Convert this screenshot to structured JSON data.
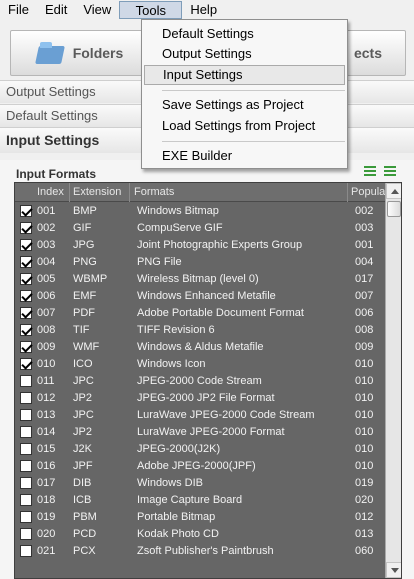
{
  "menubar": {
    "items": [
      {
        "label": "File"
      },
      {
        "label": "Edit"
      },
      {
        "label": "View"
      },
      {
        "label": "Tools"
      },
      {
        "label": "Help"
      }
    ]
  },
  "toolbar": {
    "folders_label": "Folders",
    "projects_label_visible": "ects"
  },
  "accordion": {
    "output_settings": "Output Settings",
    "default_settings": "Default Settings",
    "input_settings": "Input Settings"
  },
  "panel": {
    "title": "Input Formats"
  },
  "grid": {
    "columns": [
      "Index",
      "Extension",
      "Formats",
      "Popularity"
    ],
    "rows": [
      {
        "checked": true,
        "index": "001",
        "ext": "BMP",
        "format": "Windows Bitmap",
        "pop": "002"
      },
      {
        "checked": true,
        "index": "002",
        "ext": "GIF",
        "format": "CompuServe GIF",
        "pop": "003"
      },
      {
        "checked": true,
        "index": "003",
        "ext": "JPG",
        "format": "Joint Photographic Experts Group",
        "pop": "001"
      },
      {
        "checked": true,
        "index": "004",
        "ext": "PNG",
        "format": "PNG File",
        "pop": "004"
      },
      {
        "checked": true,
        "index": "005",
        "ext": "WBMP",
        "format": "Wireless Bitmap (level 0)",
        "pop": "017"
      },
      {
        "checked": true,
        "index": "006",
        "ext": "EMF",
        "format": "Windows Enhanced Metafile",
        "pop": "007"
      },
      {
        "checked": true,
        "index": "007",
        "ext": "PDF",
        "format": "Adobe Portable Document Format",
        "pop": "006"
      },
      {
        "checked": true,
        "index": "008",
        "ext": "TIF",
        "format": "TIFF Revision 6",
        "pop": "008"
      },
      {
        "checked": true,
        "index": "009",
        "ext": "WMF",
        "format": "Windows & Aldus Metafile",
        "pop": "009"
      },
      {
        "checked": true,
        "index": "010",
        "ext": "ICO",
        "format": "Windows Icon",
        "pop": "010"
      },
      {
        "checked": false,
        "index": "011",
        "ext": "JPC",
        "format": "JPEG-2000 Code Stream",
        "pop": "010"
      },
      {
        "checked": false,
        "index": "012",
        "ext": "JP2",
        "format": "JPEG-2000 JP2 File Format",
        "pop": "010"
      },
      {
        "checked": false,
        "index": "013",
        "ext": "JPC",
        "format": "LuraWave JPEG-2000 Code Stream",
        "pop": "010"
      },
      {
        "checked": false,
        "index": "014",
        "ext": "JP2",
        "format": "LuraWave JPEG-2000 Format",
        "pop": "010"
      },
      {
        "checked": false,
        "index": "015",
        "ext": "J2K",
        "format": "JPEG-2000(J2K)",
        "pop": "010"
      },
      {
        "checked": false,
        "index": "016",
        "ext": "JPF",
        "format": "Adobe JPEG-2000(JPF)",
        "pop": "010"
      },
      {
        "checked": false,
        "index": "017",
        "ext": "DIB",
        "format": "Windows DIB",
        "pop": "019"
      },
      {
        "checked": false,
        "index": "018",
        "ext": "ICB",
        "format": "Image Capture Board",
        "pop": "020"
      },
      {
        "checked": false,
        "index": "019",
        "ext": "PBM",
        "format": "Portable Bitmap",
        "pop": "012"
      },
      {
        "checked": false,
        "index": "020",
        "ext": "PCD",
        "format": "Kodak Photo CD",
        "pop": "013"
      },
      {
        "checked": false,
        "index": "021",
        "ext": "PCX",
        "format": "Zsoft Publisher's Paintbrush",
        "pop": "060"
      }
    ]
  },
  "tools_menu": {
    "items": [
      {
        "label": "Default Settings"
      },
      {
        "label": "Output Settings"
      },
      {
        "label": "Input Settings",
        "highlighted": true
      },
      {
        "separator": true
      },
      {
        "label": "Save Settings as Project"
      },
      {
        "label": "Load Settings from Project"
      },
      {
        "separator": true
      },
      {
        "label": "EXE Builder"
      }
    ]
  },
  "colors": {
    "grid_bg": "#666666",
    "menu_highlight": "#cfd8e6",
    "list_icon_green": "#3a9a3a"
  }
}
